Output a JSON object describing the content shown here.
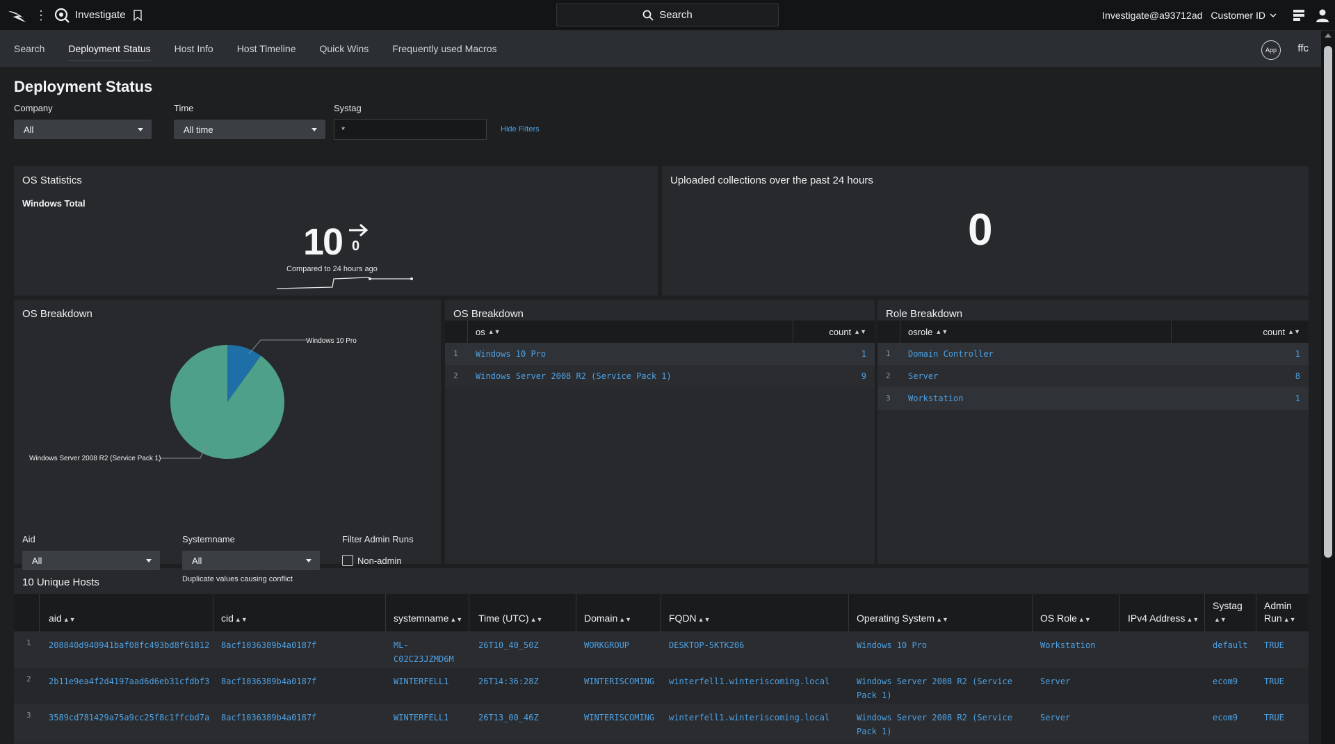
{
  "topbar": {
    "app_name": "Investigate",
    "search_label": "Search",
    "user": "Investigate@a93712ad",
    "customer_label": "Customer ID"
  },
  "nav": {
    "tabs": [
      "Search",
      "Deployment Status",
      "Host Info",
      "Host Timeline",
      "Quick Wins",
      "Frequently used Macros"
    ],
    "active_tab": "Deployment Status",
    "app_badge": "App",
    "app_short": "ffc"
  },
  "page": {
    "title": "Deployment Status",
    "filters": {
      "company_label": "Company",
      "company_value": "All",
      "time_label": "Time",
      "time_value": "All time",
      "systag_label": "Systag",
      "systag_value": "*",
      "hide_filters": "Hide Filters"
    }
  },
  "os_statistics": {
    "title": "OS Statistics",
    "subtitle": "Windows Total",
    "value": "10",
    "delta": "0",
    "caption": "Compared to 24 hours ago"
  },
  "uploaded": {
    "title": "Uploaded collections over the past 24 hours",
    "value": "0"
  },
  "os_breakdown_chart": {
    "title": "OS Breakdown",
    "label_a": "Windows 10 Pro",
    "label_b": "Windows Server 2008 R2 (Service Pack 1)"
  },
  "chart_data": {
    "type": "pie",
    "categories": [
      "Windows 10 Pro",
      "Windows Server 2008 R2 (Service Pack 1)"
    ],
    "values": [
      1,
      9
    ],
    "colors": [
      "#1e6fa8",
      "#4fa088"
    ]
  },
  "os_breakdown_table": {
    "title": "OS Breakdown",
    "col_os": "os",
    "col_count": "count",
    "rows": [
      {
        "n": "1",
        "os": "Windows 10 Pro",
        "count": "1"
      },
      {
        "n": "2",
        "os": "Windows Server 2008 R2 (Service Pack 1)",
        "count": "9"
      }
    ]
  },
  "role_breakdown": {
    "title": "Role Breakdown",
    "col_role": "osrole",
    "col_count": "count",
    "rows": [
      {
        "n": "1",
        "role": "Domain Controller",
        "count": "1"
      },
      {
        "n": "2",
        "role": "Server",
        "count": "8"
      },
      {
        "n": "3",
        "role": "Workstation",
        "count": "1"
      }
    ]
  },
  "hosts": {
    "title": "10 Unique Hosts",
    "aid_label": "Aid",
    "aid_value": "All",
    "systemname_label": "Systemname",
    "systemname_value": "All",
    "duplicate_note": "Duplicate values causing conflict",
    "filter_admin_label": "Filter Admin Runs",
    "non_admin_label": "Non-admin",
    "columns": {
      "aid": "aid",
      "cid": "cid",
      "systemname": "systemname",
      "time": "Time (UTC)",
      "domain": "Domain",
      "fqdn": "FQDN",
      "os": "Operating System",
      "role": "OS Role",
      "ipv4": "IPv4 Address",
      "systag": "Systag",
      "admin_1": "Admin",
      "admin_2": "Run"
    },
    "rows": [
      {
        "n": "1",
        "aid": "208840d940941baf08fc493bd8f61812",
        "cid": "8acf1036389b4a0187f",
        "systemname_1": "ML-",
        "systemname_2": "C02C23JZMD6M",
        "time": "26T10_40_50Z",
        "domain": "WORKGROUP",
        "fqdn": "DESKTOP-5KTK206",
        "os_1": "Windows 10 Pro",
        "os_2": "",
        "role": "Workstation",
        "systag": "default",
        "admin": "TRUE"
      },
      {
        "n": "2",
        "aid": "2b11e9ea4f2d4197aad6d6eb31cfdbf3",
        "cid": "8acf1036389b4a0187f",
        "systemname_1": "WINTERFELL1",
        "systemname_2": "",
        "time": "26T14:36:28Z",
        "domain": "WINTERISCOMING",
        "fqdn": "winterfell1.winteriscoming.local",
        "os_1": "Windows Server 2008 R2 (Service",
        "os_2": "Pack 1)",
        "role": "Server",
        "systag": "ecom9",
        "admin": "TRUE"
      },
      {
        "n": "3",
        "aid": "3589cd781429a75a9cc25f8c1ffcbd7a",
        "cid": "8acf1036389b4a0187f",
        "systemname_1": "WINTERFELL1",
        "systemname_2": "",
        "time": "26T13_00_46Z",
        "domain": "WINTERISCOMING",
        "fqdn": "winterfell1.winteriscoming.local",
        "os_1": "Windows Server 2008 R2 (Service",
        "os_2": "Pack 1)",
        "role": "Server",
        "systag": "ecom9",
        "admin": "TRUE"
      }
    ]
  }
}
